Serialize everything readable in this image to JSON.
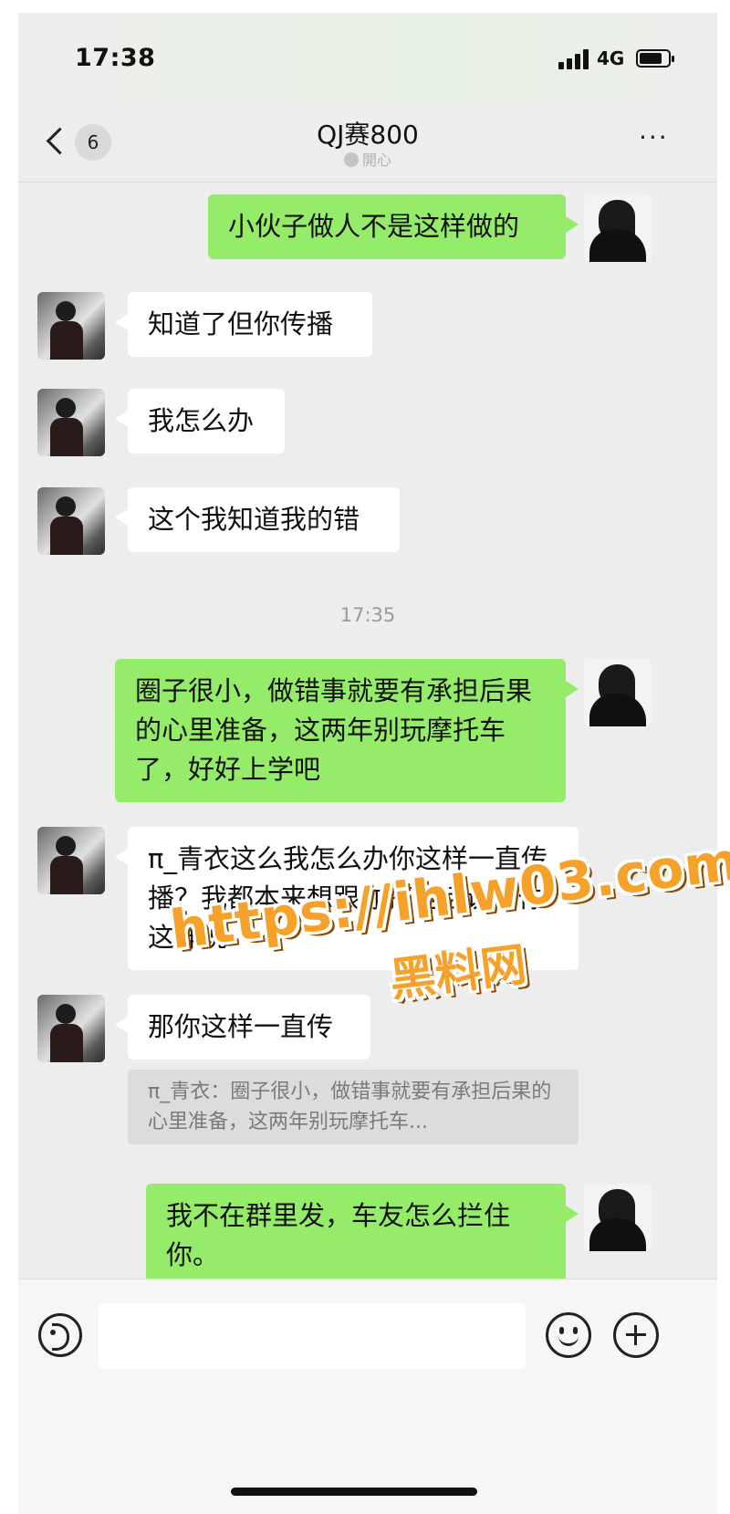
{
  "status_bar": {
    "time": "17:38",
    "network": "4G"
  },
  "nav": {
    "unread_count": "6",
    "title": "QJ赛800",
    "subtitle": "開心",
    "more": "···"
  },
  "messages": [
    {
      "side": "out",
      "text": "小伙子做人不是这样做的"
    },
    {
      "side": "in",
      "text": "知道了但你传播"
    },
    {
      "side": "in",
      "text": "我怎么办"
    },
    {
      "side": "in",
      "text": "这个我知道我的错"
    },
    {
      "side": "out",
      "text": "圈子很小，做错事就要有承担后果的心里准备，这两年别玩摩托车了，好好上学吧"
    },
    {
      "side": "in",
      "text": "π_青衣这么我怎么办你这样一直传播？我都本来想跟你打电话说的你这样说"
    },
    {
      "side": "in",
      "text": "那你这样一直传"
    },
    {
      "side": "out",
      "text": "我不在群里发，车友怎么拦住你。"
    }
  ],
  "timestamp": "17:35",
  "quote": "π_青衣：圈子很小，做错事就要有承担后果的心里准备，这两年别玩摩托车...",
  "input": {
    "value": "",
    "placeholder": ""
  },
  "watermark": {
    "url": "https://ihlw03.com",
    "name": "黑料网"
  },
  "colors": {
    "outgoing_bubble": "#95ec69",
    "incoming_bubble": "#ffffff",
    "background": "#ededed",
    "watermark": "#f5a12a"
  }
}
